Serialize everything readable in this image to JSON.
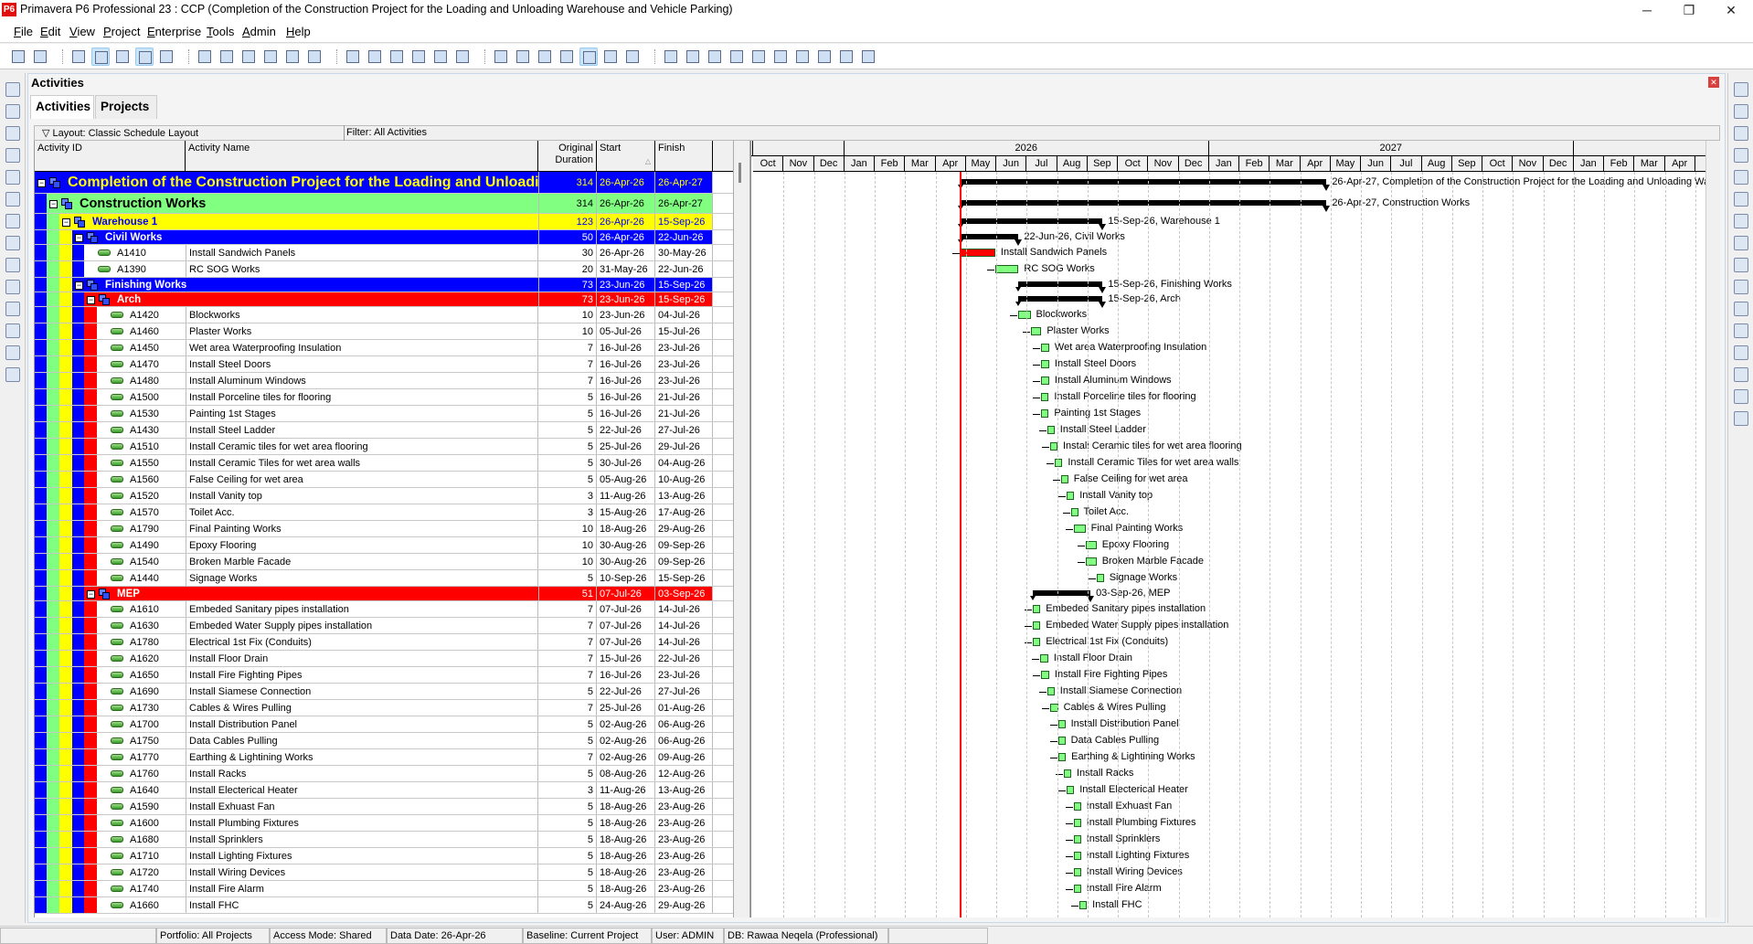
{
  "window": {
    "title": "Primavera P6 Professional 23 : CCP (Completion of the Construction Project for the Loading and Unloading Warehouse and Vehicle Parking)",
    "logo": "P6"
  },
  "menu": [
    "File",
    "Edit",
    "View",
    "Project",
    "Enterprise",
    "Tools",
    "Admin",
    "Help"
  ],
  "toolbar": {
    "groups": [
      [
        "print-icon",
        "print-preview-icon"
      ],
      [
        "activity-table-icon",
        "gantt-chart-icon",
        "activity-network-icon",
        "trace-logic-icon",
        "hierarchy-icon"
      ],
      [
        "reports-icon",
        "activity-details-icon",
        "resource-usage-icon",
        "assignments-icon",
        "resource-profile-icon",
        "progress-spotlight-icon"
      ],
      [
        "bars-icon",
        "columns-icon",
        "group-sort-icon",
        "filter-icon",
        "layout-options-icon",
        "hash-icon"
      ],
      [
        "spreadsheet-icon",
        "schedule-icon",
        "level-icon",
        "apply-actuals-icon",
        "data-date-icon",
        "store-period-icon",
        "timescale-icon"
      ],
      [
        "zoom-in-icon",
        "zoom-out-icon",
        "zoom-fit-icon",
        "split-icon",
        "diamond-icon",
        "panes-icon",
        "notes-icon",
        "help-icon",
        "broadcast-icon",
        "web-icon"
      ]
    ],
    "active": [
      "gantt-chart-icon",
      "trace-logic-icon",
      "data-date-icon"
    ]
  },
  "panel": {
    "title": "Activities",
    "tabs": [
      "Activities",
      "Projects"
    ],
    "layout_label": "Layout: Classic Schedule Layout",
    "filter_label": "Filter: All Activities"
  },
  "columns": {
    "id": "Activity ID",
    "name": "Activity Name",
    "duration": "Original Duration",
    "start": "Start",
    "finish": "Finish"
  },
  "data_date": "26-Apr-26",
  "timescale": {
    "years": [
      {
        "label": "",
        "months": 3
      },
      {
        "label": "2026",
        "months": 12
      },
      {
        "label": "2027",
        "months": 12
      },
      {
        "label": "",
        "months": 5
      }
    ],
    "months": [
      "Oct",
      "Nov",
      "Dec",
      "Jan",
      "Feb",
      "Mar",
      "Apr",
      "May",
      "Jun",
      "Jul",
      "Aug",
      "Sep",
      "Oct",
      "Nov",
      "Dec",
      "Jan",
      "Feb",
      "Mar",
      "Apr",
      "May",
      "Jun",
      "Jul",
      "Aug",
      "Sep",
      "Oct",
      "Nov",
      "Dec",
      "Jan",
      "Feb",
      "Mar",
      "Apr",
      "M"
    ]
  },
  "colors": {
    "data_date_line": "#ff0000",
    "activity_bar": "#80ff80",
    "summary_bar": "#000000"
  },
  "rows": [
    {
      "type": "wbs",
      "level": 0,
      "name": "Completion of the Construction Project for the Loading and Unloading Warehouse and Vehicle Parking",
      "dur": "314",
      "start": "26-Apr-26",
      "finish": "26-Apr-27",
      "bg": "#0000ff",
      "fg": "#ffff00",
      "size": "large"
    },
    {
      "type": "wbs",
      "level": 1,
      "name": "Construction Works",
      "dur": "314",
      "start": "26-Apr-26",
      "finish": "26-Apr-27",
      "bg": "#80ff80",
      "fg": "#000000",
      "size": "medium"
    },
    {
      "type": "wbs",
      "level": 2,
      "name": "Warehouse 1",
      "dur": "123",
      "start": "26-Apr-26",
      "finish": "15-Sep-26",
      "bg": "#ffff00",
      "fg": "#0000ff"
    },
    {
      "type": "wbs",
      "level": 3,
      "name": "Civil Works",
      "dur": "50",
      "start": "26-Apr-26",
      "finish": "22-Jun-26",
      "bg": "#0000ff",
      "fg": "#ffffff"
    },
    {
      "type": "act",
      "level": 4,
      "id": "A1410",
      "name": "Install Sandwich Panels",
      "dur": "30",
      "start": "26-Apr-26",
      "finish": "30-May-26",
      "bar_color": "#ff0000"
    },
    {
      "type": "act",
      "level": 4,
      "id": "A1390",
      "name": "RC SOG Works",
      "dur": "20",
      "start": "31-May-26",
      "finish": "22-Jun-26"
    },
    {
      "type": "wbs",
      "level": 3,
      "name": "Finishing Works",
      "dur": "73",
      "start": "23-Jun-26",
      "finish": "15-Sep-26",
      "bg": "#0000ff",
      "fg": "#ffffff"
    },
    {
      "type": "wbs",
      "level": 4,
      "name": "Arch",
      "dur": "73",
      "start": "23-Jun-26",
      "finish": "15-Sep-26",
      "bg": "#ff0000",
      "fg": "#ffffff"
    },
    {
      "type": "act",
      "level": 5,
      "id": "A1420",
      "name": "Blockworks",
      "dur": "10",
      "start": "23-Jun-26",
      "finish": "04-Jul-26"
    },
    {
      "type": "act",
      "level": 5,
      "id": "A1460",
      "name": "Plaster Works",
      "dur": "10",
      "start": "05-Jul-26",
      "finish": "15-Jul-26"
    },
    {
      "type": "act",
      "level": 5,
      "id": "A1450",
      "name": "Wet area Waterproofing Insulation",
      "dur": "7",
      "start": "16-Jul-26",
      "finish": "23-Jul-26"
    },
    {
      "type": "act",
      "level": 5,
      "id": "A1470",
      "name": "Install Steel Doors",
      "dur": "7",
      "start": "16-Jul-26",
      "finish": "23-Jul-26"
    },
    {
      "type": "act",
      "level": 5,
      "id": "A1480",
      "name": "Install Aluminum Windows",
      "dur": "7",
      "start": "16-Jul-26",
      "finish": "23-Jul-26"
    },
    {
      "type": "act",
      "level": 5,
      "id": "A1500",
      "name": "Install Porceline tiles for flooring",
      "dur": "5",
      "start": "16-Jul-26",
      "finish": "21-Jul-26"
    },
    {
      "type": "act",
      "level": 5,
      "id": "A1530",
      "name": "Painting 1st Stages",
      "dur": "5",
      "start": "16-Jul-26",
      "finish": "21-Jul-26"
    },
    {
      "type": "act",
      "level": 5,
      "id": "A1430",
      "name": "Install Steel Ladder",
      "dur": "5",
      "start": "22-Jul-26",
      "finish": "27-Jul-26"
    },
    {
      "type": "act",
      "level": 5,
      "id": "A1510",
      "name": "Install Ceramic tiles for wet area flooring",
      "dur": "5",
      "start": "25-Jul-26",
      "finish": "29-Jul-26"
    },
    {
      "type": "act",
      "level": 5,
      "id": "A1550",
      "name": "Install Ceramic Tiles for wet area walls",
      "dur": "5",
      "start": "30-Jul-26",
      "finish": "04-Aug-26"
    },
    {
      "type": "act",
      "level": 5,
      "id": "A1560",
      "name": "False Ceiling for wet area",
      "dur": "5",
      "start": "05-Aug-26",
      "finish": "10-Aug-26"
    },
    {
      "type": "act",
      "level": 5,
      "id": "A1520",
      "name": "Install Vanity top",
      "dur": "3",
      "start": "11-Aug-26",
      "finish": "13-Aug-26"
    },
    {
      "type": "act",
      "level": 5,
      "id": "A1570",
      "name": "Toilet Acc.",
      "dur": "3",
      "start": "15-Aug-26",
      "finish": "17-Aug-26"
    },
    {
      "type": "act",
      "level": 5,
      "id": "A1790",
      "name": "Final Painting Works",
      "dur": "10",
      "start": "18-Aug-26",
      "finish": "29-Aug-26"
    },
    {
      "type": "act",
      "level": 5,
      "id": "A1490",
      "name": "Epoxy Flooring",
      "dur": "10",
      "start": "30-Aug-26",
      "finish": "09-Sep-26"
    },
    {
      "type": "act",
      "level": 5,
      "id": "A1540",
      "name": "Broken Marble Facade",
      "dur": "10",
      "start": "30-Aug-26",
      "finish": "09-Sep-26"
    },
    {
      "type": "act",
      "level": 5,
      "id": "A1440",
      "name": "Signage Works",
      "dur": "5",
      "start": "10-Sep-26",
      "finish": "15-Sep-26"
    },
    {
      "type": "wbs",
      "level": 4,
      "name": "MEP",
      "dur": "51",
      "start": "07-Jul-26",
      "finish": "03-Sep-26",
      "bg": "#ff0000",
      "fg": "#ffffff"
    },
    {
      "type": "act",
      "level": 5,
      "id": "A1610",
      "name": "Embeded Sanitary pipes installation",
      "dur": "7",
      "start": "07-Jul-26",
      "finish": "14-Jul-26"
    },
    {
      "type": "act",
      "level": 5,
      "id": "A1630",
      "name": "Embeded Water Supply pipes installation",
      "dur": "7",
      "start": "07-Jul-26",
      "finish": "14-Jul-26"
    },
    {
      "type": "act",
      "level": 5,
      "id": "A1780",
      "name": "Electrical 1st Fix (Conduits)",
      "dur": "7",
      "start": "07-Jul-26",
      "finish": "14-Jul-26"
    },
    {
      "type": "act",
      "level": 5,
      "id": "A1620",
      "name": "Install Floor Drain",
      "dur": "7",
      "start": "15-Jul-26",
      "finish": "22-Jul-26"
    },
    {
      "type": "act",
      "level": 5,
      "id": "A1650",
      "name": "Install Fire Fighting Pipes",
      "dur": "7",
      "start": "16-Jul-26",
      "finish": "23-Jul-26"
    },
    {
      "type": "act",
      "level": 5,
      "id": "A1690",
      "name": "Install Siamese Connection",
      "dur": "5",
      "start": "22-Jul-26",
      "finish": "27-Jul-26"
    },
    {
      "type": "act",
      "level": 5,
      "id": "A1730",
      "name": "Cables & Wires Pulling",
      "dur": "7",
      "start": "25-Jul-26",
      "finish": "01-Aug-26"
    },
    {
      "type": "act",
      "level": 5,
      "id": "A1700",
      "name": "Install Distribution Panel",
      "dur": "5",
      "start": "02-Aug-26",
      "finish": "06-Aug-26"
    },
    {
      "type": "act",
      "level": 5,
      "id": "A1750",
      "name": "Data Cables Pulling",
      "dur": "5",
      "start": "02-Aug-26",
      "finish": "06-Aug-26"
    },
    {
      "type": "act",
      "level": 5,
      "id": "A1770",
      "name": "Earthing & Lightining Works",
      "dur": "7",
      "start": "02-Aug-26",
      "finish": "09-Aug-26"
    },
    {
      "type": "act",
      "level": 5,
      "id": "A1760",
      "name": "Install Racks",
      "dur": "5",
      "start": "08-Aug-26",
      "finish": "12-Aug-26"
    },
    {
      "type": "act",
      "level": 5,
      "id": "A1640",
      "name": "Install Electerical Heater",
      "dur": "3",
      "start": "11-Aug-26",
      "finish": "13-Aug-26"
    },
    {
      "type": "act",
      "level": 5,
      "id": "A1590",
      "name": "Install Exhuast Fan",
      "dur": "5",
      "start": "18-Aug-26",
      "finish": "23-Aug-26"
    },
    {
      "type": "act",
      "level": 5,
      "id": "A1600",
      "name": "Install Plumbing Fixtures",
      "dur": "5",
      "start": "18-Aug-26",
      "finish": "23-Aug-26"
    },
    {
      "type": "act",
      "level": 5,
      "id": "A1680",
      "name": "Install Sprinklers",
      "dur": "5",
      "start": "18-Aug-26",
      "finish": "23-Aug-26"
    },
    {
      "type": "act",
      "level": 5,
      "id": "A1710",
      "name": "Install Lighting Fixtures",
      "dur": "5",
      "start": "18-Aug-26",
      "finish": "23-Aug-26"
    },
    {
      "type": "act",
      "level": 5,
      "id": "A1720",
      "name": "Install Wiring Devices",
      "dur": "5",
      "start": "18-Aug-26",
      "finish": "23-Aug-26"
    },
    {
      "type": "act",
      "level": 5,
      "id": "A1740",
      "name": "Install Fire Alarm",
      "dur": "5",
      "start": "18-Aug-26",
      "finish": "23-Aug-26"
    },
    {
      "type": "act",
      "level": 5,
      "id": "A1660",
      "name": "Install FHC",
      "dur": "5",
      "start": "24-Aug-26",
      "finish": "29-Aug-26"
    }
  ],
  "statusbar": [
    "Portfolio: All Projects",
    "Access Mode: Shared",
    "Data Date: 26-Apr-26",
    "Baseline: Current Project",
    "User: ADMIN",
    "DB: Rawaa Neqela (Professional)"
  ]
}
